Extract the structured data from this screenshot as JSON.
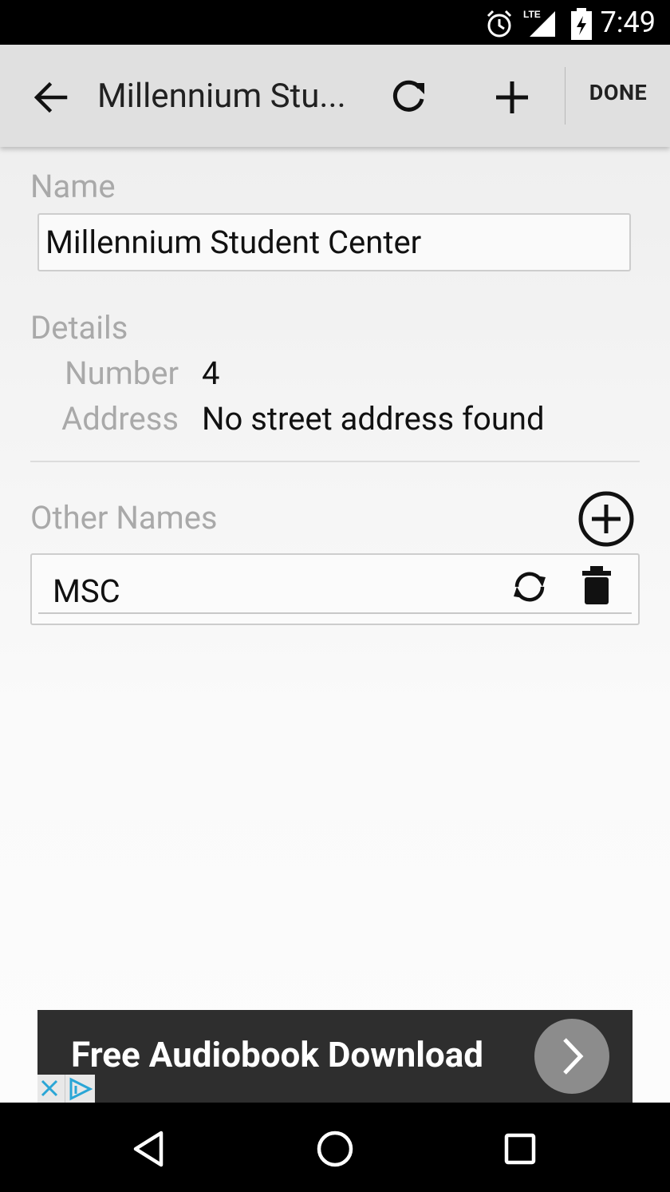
{
  "status_bar": {
    "time": "7:49",
    "network": "LTE"
  },
  "toolbar": {
    "title": "Millennium Stu...",
    "done_label": "DONE",
    "icons": [
      "back-arrow-icon",
      "refresh-icon",
      "add-icon"
    ]
  },
  "form": {
    "name_label": "Name",
    "name_value": "Millennium Student Center",
    "details_label": "Details",
    "number_label": "Number",
    "number_value": "4",
    "address_label": "Address",
    "address_value": "No street address found",
    "other_names_label": "Other Names",
    "other_names": [
      {
        "value": "MSC"
      }
    ]
  },
  "ad": {
    "text": "Free Audiobook Download",
    "colors": {
      "background": "#2e2e2e",
      "button": "#8c8c8c"
    }
  },
  "colors": {
    "toolbar_bg": "#e0e0e0",
    "label_gray": "#a9a9a9",
    "text_dark": "#111111"
  }
}
